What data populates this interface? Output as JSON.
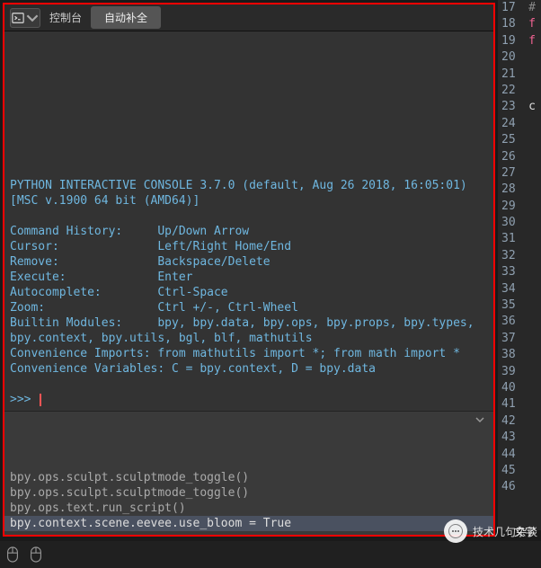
{
  "header": {
    "editor_type_icon": "console-icon",
    "label_console": "控制台",
    "btn_autocomplete": "自动补全"
  },
  "console": {
    "banner": "PYTHON INTERACTIVE CONSOLE 3.7.0 (default, Aug 26 2018, 16:05:01) [MSC v.1900 64 bit (AMD64)]",
    "help": [
      "Command History:     Up/Down Arrow",
      "Cursor:              Left/Right Home/End",
      "Remove:              Backspace/Delete",
      "Execute:             Enter",
      "Autocomplete:        Ctrl-Space",
      "Zoom:                Ctrl +/-, Ctrl-Wheel",
      "Builtin Modules:     bpy, bpy.data, bpy.ops, bpy.props, bpy.types, bpy.context, bpy.utils, bgl, blf, mathutils",
      "Convenience Imports: from mathutils import *; from math import *",
      "Convenience Variables: C = bpy.context, D = bpy.data"
    ],
    "prompt": ">>> "
  },
  "history": {
    "lines": [
      "bpy.ops.sculpt.sculptmode_toggle()",
      "bpy.ops.sculpt.sculptmode_toggle()",
      "bpy.ops.text.run_script()",
      "bpy.context.scene.eevee.use_bloom = True"
    ]
  },
  "gutter": {
    "start": 17,
    "end": 46,
    "fragments": {
      "17": "#",
      "18": "f",
      "19": "f",
      "23": "c"
    },
    "wenzi_label": "文字"
  },
  "watermark": {
    "text": "技术几句杂谈"
  }
}
